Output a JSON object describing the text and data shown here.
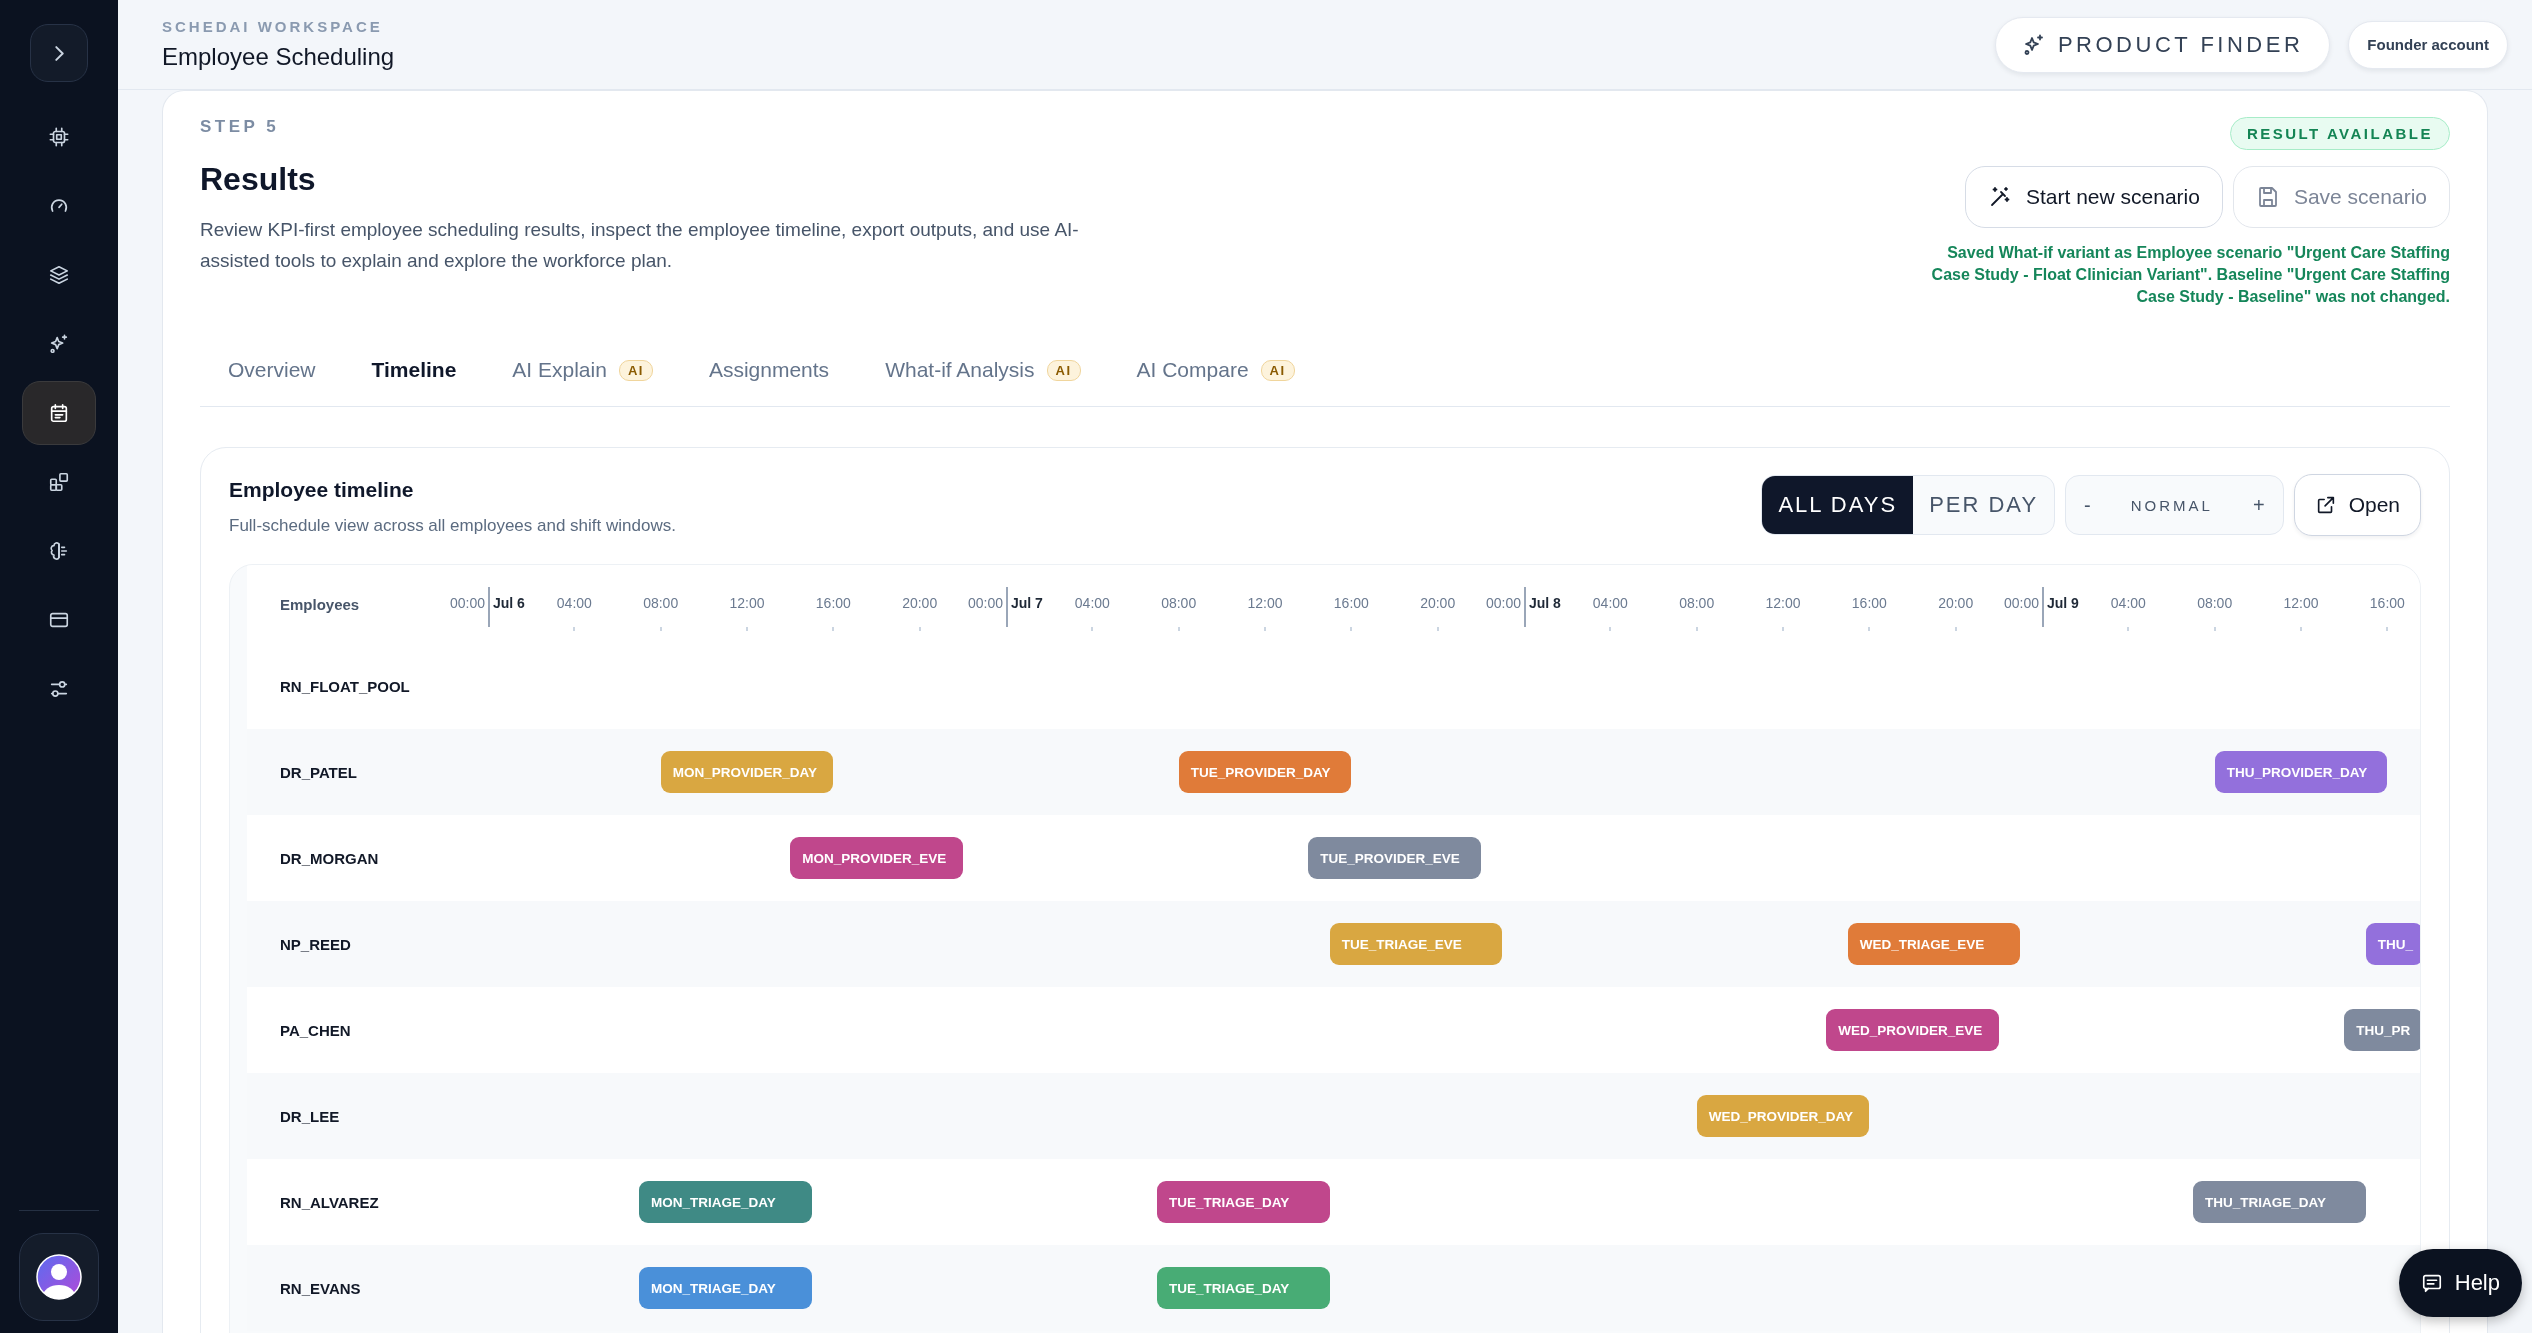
{
  "sidebar": {
    "items": [
      {
        "selected": false
      },
      {
        "selected": false
      },
      {
        "selected": false
      },
      {
        "selected": false
      },
      {
        "selected": true
      },
      {
        "selected": false
      },
      {
        "selected": false
      },
      {
        "selected": false
      },
      {
        "selected": false
      }
    ]
  },
  "header": {
    "workspace": "SCHEDAI WORKSPACE",
    "title": "Employee Scheduling",
    "product_finder": "PRODUCT FINDER",
    "account": "Founder account"
  },
  "results": {
    "step": "STEP 5",
    "title": "Results",
    "description": "Review KPI-first employee scheduling results, inspect the employee timeline, export outputs, and use AI-assisted tools to explain and explore the workforce plan.",
    "status_badge": "RESULT AVAILABLE",
    "buttons": [
      {
        "label": "Start new scenario",
        "disabled": false
      },
      {
        "label": "Save scenario",
        "disabled": true
      }
    ],
    "message": "Saved What-if variant as Employee scenario \"Urgent Care Staffing Case Study - Float Clinician Variant\". Baseline \"Urgent Care Staffing Case Study - Baseline\" was not changed."
  },
  "tabs": [
    {
      "label": "Overview",
      "selected": false
    },
    {
      "label": "Timeline",
      "selected": true
    },
    {
      "label": "AI Explain",
      "selected": false,
      "badge": "AI"
    },
    {
      "label": "Assignments",
      "selected": false
    },
    {
      "label": "What-if Analysis",
      "selected": false,
      "badge": "AI"
    },
    {
      "label": "AI Compare",
      "selected": false,
      "badge": "AI"
    }
  ],
  "timeline": {
    "title": "Employee timeline",
    "subtitle": "Full-schedule view across all employees and shift windows.",
    "view_modes": [
      {
        "label": "ALL DAYS",
        "selected": true
      },
      {
        "label": "PER DAY",
        "selected": false
      }
    ],
    "zoom": {
      "minus": "-",
      "label": "NORMAL",
      "plus": "+"
    },
    "open_button": "Open",
    "column_header": "Employees",
    "days": [
      {
        "date": "Jul 6",
        "ticks": [
          "00:00",
          "04:00",
          "08:00",
          "12:00",
          "16:00",
          "20:00"
        ]
      },
      {
        "date": "Jul 7",
        "ticks": [
          "00:00",
          "04:00",
          "08:00",
          "12:00",
          "16:00",
          "20:00"
        ]
      },
      {
        "date": "Jul 8",
        "ticks": [
          "00:00",
          "04:00",
          "08:00",
          "12:00",
          "16:00",
          "20:00"
        ]
      },
      {
        "date": "Jul 9",
        "ticks": [
          "00:00",
          "04:00",
          "08:00",
          "12:00",
          "16:00"
        ]
      }
    ],
    "rows": [
      {
        "employee": "RN_FLOAT_POOL",
        "shifts": []
      },
      {
        "employee": "DR_PATEL",
        "shifts": [
          {
            "label": "MON_PROVIDER_DAY",
            "color": "#d9a741"
          },
          {
            "label": "TUE_PROVIDER_DAY",
            "color": "#e07b39"
          },
          {
            "label": "THU_PROVIDER_DAY",
            "color": "#9370dc"
          }
        ]
      },
      {
        "employee": "DR_MORGAN",
        "shifts": [
          {
            "label": "MON_PROVIDER_EVE",
            "color": "#c0478c"
          },
          {
            "label": "TUE_PROVIDER_EVE",
            "color": "#7f8a9e"
          }
        ]
      },
      {
        "employee": "NP_REED",
        "shifts": [
          {
            "label": "TUE_TRIAGE_EVE",
            "color": "#d9a741"
          },
          {
            "label": "WED_TRIAGE_EVE",
            "color": "#e07b39"
          },
          {
            "label": "THU_",
            "color": "#9370dc"
          }
        ]
      },
      {
        "employee": "PA_CHEN",
        "shifts": [
          {
            "label": "WED_PROVIDER_EVE",
            "color": "#c0478c"
          },
          {
            "label": "THU_PR",
            "color": "#7f8a9e"
          }
        ]
      },
      {
        "employee": "DR_LEE",
        "shifts": [
          {
            "label": "WED_PROVIDER_DAY",
            "color": "#d9a741"
          }
        ]
      },
      {
        "employee": "RN_ALVAREZ",
        "shifts": [
          {
            "label": "MON_TRIAGE_DAY",
            "color": "#3f8a85"
          },
          {
            "label": "TUE_TRIAGE_DAY",
            "color": "#c0478c"
          },
          {
            "label": "THU_TRIAGE_DAY",
            "color": "#7f8a9e"
          }
        ]
      },
      {
        "employee": "RN_EVANS",
        "shifts": [
          {
            "label": "MON_TRIAGE_DAY",
            "color": "#4a90d9"
          },
          {
            "label": "TUE_TRIAGE_DAY",
            "color": "#48ac75"
          }
        ]
      }
    ]
  },
  "help_button": "Help"
}
